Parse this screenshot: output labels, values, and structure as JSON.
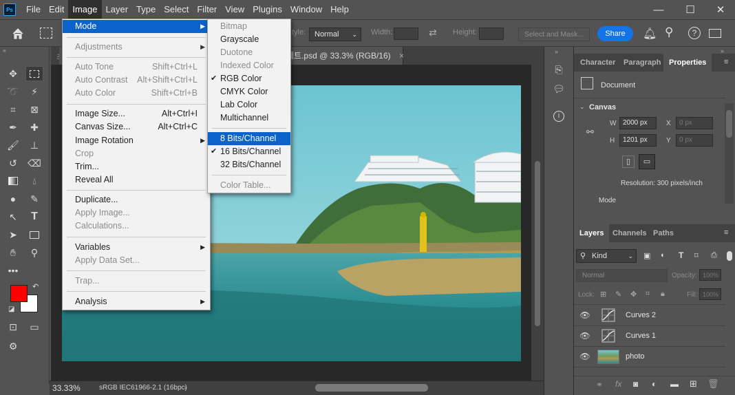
{
  "menubar": {
    "logo": "Ps",
    "items": [
      "File",
      "Edit",
      "Image",
      "Layer",
      "Type",
      "Select",
      "Filter",
      "View",
      "Plugins",
      "Window",
      "Help"
    ],
    "active": "Image"
  },
  "window_controls": {
    "minimize": "—",
    "maximize": "☐",
    "close": "✕"
  },
  "options": {
    "style_label": "tyle:",
    "style_value": "Normal",
    "width_label": "Width:",
    "height_label": "Height:",
    "select_mask": "Select and Mask...",
    "share": "Share"
  },
  "tab": {
    "title": "세트.psd @ 33.3% (RGB/16)",
    "close": "×"
  },
  "status": {
    "zoom": "33.33%",
    "profile": "sRGB IEC61966-2.1 (16bpc)"
  },
  "image_menu": {
    "mode": "Mode",
    "adjustments": "Adjustments",
    "auto_tone": "Auto Tone",
    "auto_tone_sc": "Shift+Ctrl+L",
    "auto_contrast": "Auto Contrast",
    "auto_contrast_sc": "Alt+Shift+Ctrl+L",
    "auto_color": "Auto Color",
    "auto_color_sc": "Shift+Ctrl+B",
    "image_size": "Image Size...",
    "image_size_sc": "Alt+Ctrl+I",
    "canvas_size": "Canvas Size...",
    "canvas_size_sc": "Alt+Ctrl+C",
    "image_rotation": "Image Rotation",
    "crop": "Crop",
    "trim": "Trim...",
    "reveal_all": "Reveal All",
    "duplicate": "Duplicate...",
    "apply_image": "Apply Image...",
    "calculations": "Calculations...",
    "variables": "Variables",
    "apply_data_set": "Apply Data Set...",
    "trap": "Trap...",
    "analysis": "Analysis"
  },
  "mode_menu": {
    "bitmap": "Bitmap",
    "grayscale": "Grayscale",
    "duotone": "Duotone",
    "indexed": "Indexed Color",
    "rgb": "RGB Color",
    "cmyk": "CMYK Color",
    "lab": "Lab Color",
    "multichannel": "Multichannel",
    "bits8": "8 Bits/Channel",
    "bits16": "16 Bits/Channel",
    "bits32": "32 Bits/Channel",
    "color_table": "Color Table..."
  },
  "properties": {
    "tabs": [
      "Character",
      "Paragraph",
      "Properties"
    ],
    "doc_label": "Document",
    "canvas_label": "Canvas",
    "w_label": "W",
    "w_value": "2000 px",
    "h_label": "H",
    "h_value": "1201 px",
    "x_label": "X",
    "x_placeholder": "0 px",
    "y_label": "Y",
    "y_placeholder": "0 px",
    "resolution": "Resolution: 300 pixels/inch",
    "mode_label": "Mode"
  },
  "layers": {
    "tabs": [
      "Layers",
      "Channels",
      "Paths"
    ],
    "kind": "Kind",
    "blend": "Normal",
    "opacity_label": "Opacity:",
    "opacity_value": "100%",
    "lock_label": "Lock:",
    "fill_label": "Fill:",
    "fill_value": "100%",
    "items": [
      "Curves 2",
      "Curves 1",
      "photo"
    ]
  },
  "colors": {
    "foreground": "#ff0000",
    "background": "#ffffff",
    "accent": "#1473e6",
    "highlight": "#0b63c9"
  }
}
